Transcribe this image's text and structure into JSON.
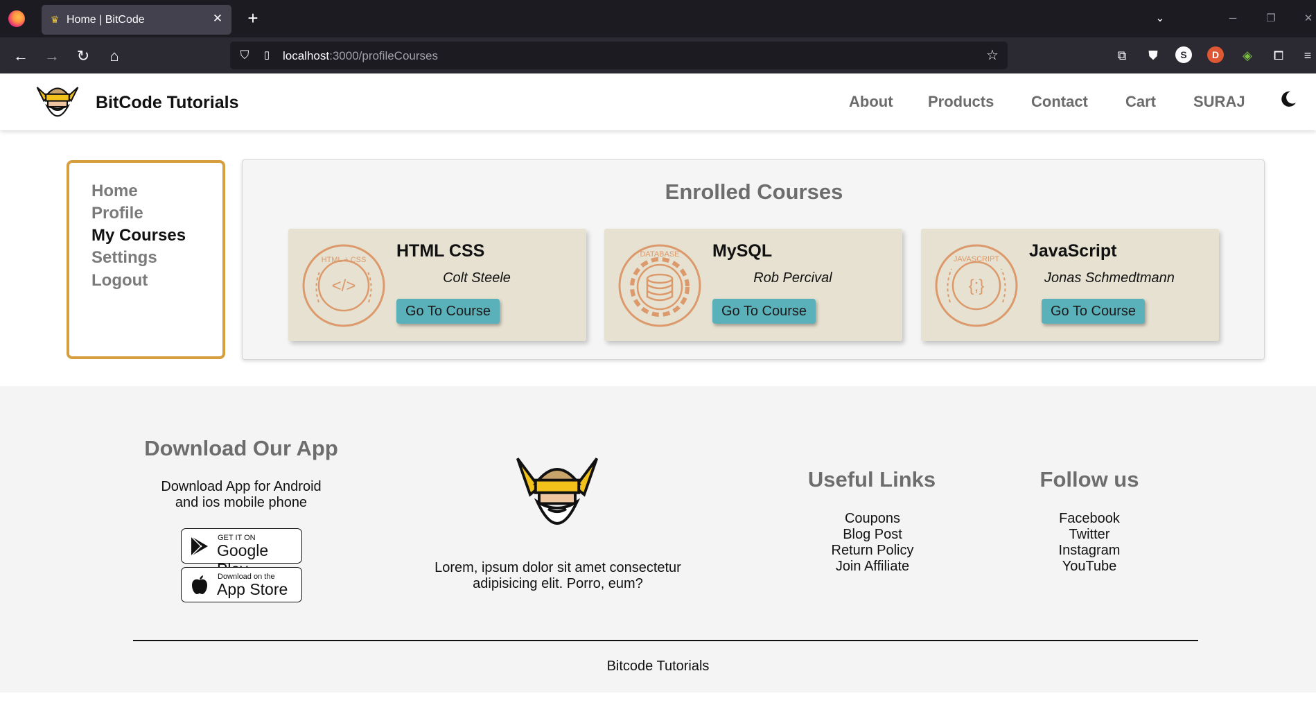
{
  "browser": {
    "tab_title": "Home | BitCode",
    "url_host": "localhost",
    "url_path": ":3000/profileCourses",
    "extensions": [
      "downloads-icon",
      "pocket-icon",
      "s-extension-icon",
      "duckduckgo-icon",
      "colorful-extension-icon",
      "extensions-icon",
      "menu-icon"
    ]
  },
  "site": {
    "brand": "BitCode Tutorials",
    "menu": [
      "About",
      "Products",
      "Contact",
      "Cart",
      "SURAJ"
    ]
  },
  "sidebar": {
    "items": [
      {
        "label": "Home",
        "active": false
      },
      {
        "label": "Profile",
        "active": false
      },
      {
        "label": "My Courses",
        "active": true
      },
      {
        "label": "Settings",
        "active": false
      },
      {
        "label": "Logout",
        "active": false
      }
    ]
  },
  "courses": {
    "title": "Enrolled Courses",
    "items": [
      {
        "title": "HTML CSS",
        "author": "Colt Steele",
        "button": "Go To Course",
        "badge": "HTML + CSS",
        "badge_symbol": "</>"
      },
      {
        "title": "MySQL",
        "author": "Rob Percival",
        "button": "Go To Course",
        "badge": "DATABASE",
        "badge_symbol": "db"
      },
      {
        "title": "JavaScript",
        "author": "Jonas Schmedtmann",
        "button": "Go To Course",
        "badge": "JAVASCRIPT",
        "badge_symbol": "{;}"
      }
    ],
    "accent_color": "#5bb1b9",
    "card_color": "#e6e1d0"
  },
  "footer": {
    "app_heading": "Download Our App",
    "app_text_line1": "Download App for Android",
    "app_text_line2": "and ios mobile phone",
    "google_play_small": "GET IT ON",
    "google_play_big": "Google Play",
    "app_store_small": "Download on the",
    "app_store_big": "App Store",
    "about_line1": "Lorem, ipsum dolor sit amet consectetur",
    "about_line2": "adipisicing elit. Porro, eum?",
    "links_heading": "Useful Links",
    "links": [
      "Coupons",
      "Blog Post",
      "Return Policy",
      "Join Affiliate"
    ],
    "follow_heading": "Follow us",
    "social": [
      "Facebook",
      "Twitter",
      "Instagram",
      "YouTube"
    ],
    "copyright": "Bitcode Tutorials"
  }
}
